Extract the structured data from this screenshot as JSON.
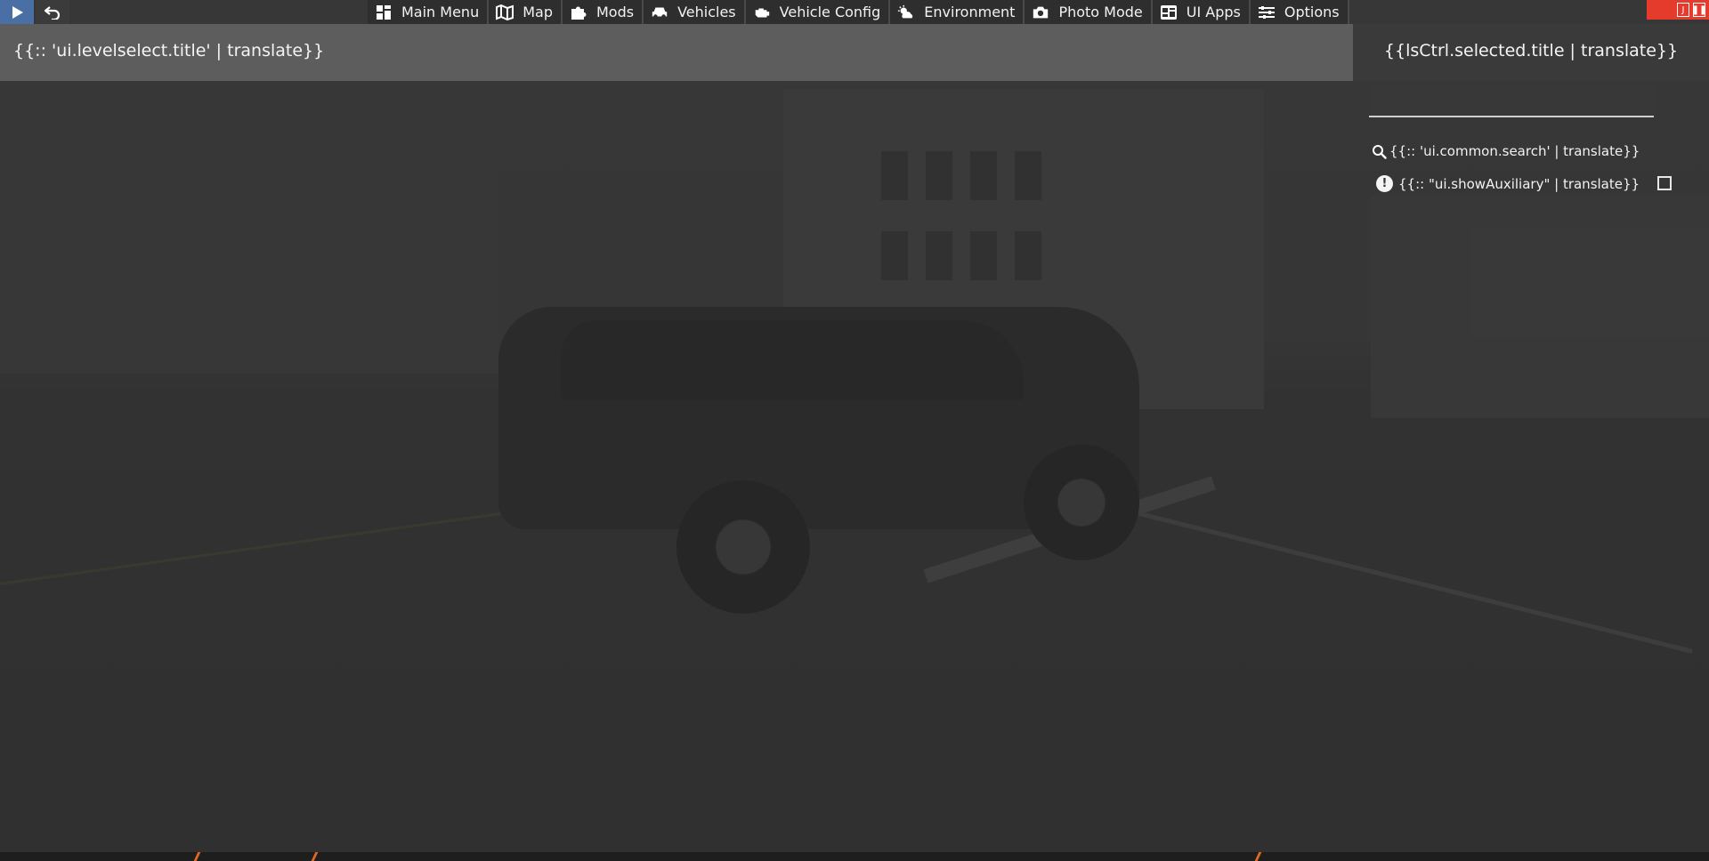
{
  "toolbar": {
    "play_icon": "play-icon",
    "undo_icon": "undo-icon"
  },
  "menu": {
    "items": [
      {
        "label": "Main Menu",
        "icon": "grid-icon"
      },
      {
        "label": "Map",
        "icon": "map-icon"
      },
      {
        "label": "Mods",
        "icon": "puzzle-icon"
      },
      {
        "label": "Vehicles",
        "icon": "car-icon"
      },
      {
        "label": "Vehicle Config",
        "icon": "engine-icon"
      },
      {
        "label": "Environment",
        "icon": "weather-icon"
      },
      {
        "label": "Photo Mode",
        "icon": "camera-icon"
      },
      {
        "label": "UI Apps",
        "icon": "apps-icon"
      },
      {
        "label": "Options",
        "icon": "sliders-icon"
      }
    ]
  },
  "corner": {
    "letter": "J",
    "color": "#e53b2c"
  },
  "header": {
    "title": "{{:: 'ui.levelselect.title' | translate}}",
    "selected_title": "{{lsCtrl.selected.title | translate}}"
  },
  "side_panel": {
    "search_value": "",
    "search_label": "{{:: 'ui.common.search' | translate}}",
    "auxiliary_label": "{{:: \"ui.showAuxiliary\" | translate}}",
    "auxiliary_checked": false
  },
  "colors": {
    "menu_bg": "#2e2e2e",
    "header_left_bg": "#5d5d5d",
    "header_right_bg": "#3a3a3a",
    "accent_orange": "#e06a1f"
  }
}
